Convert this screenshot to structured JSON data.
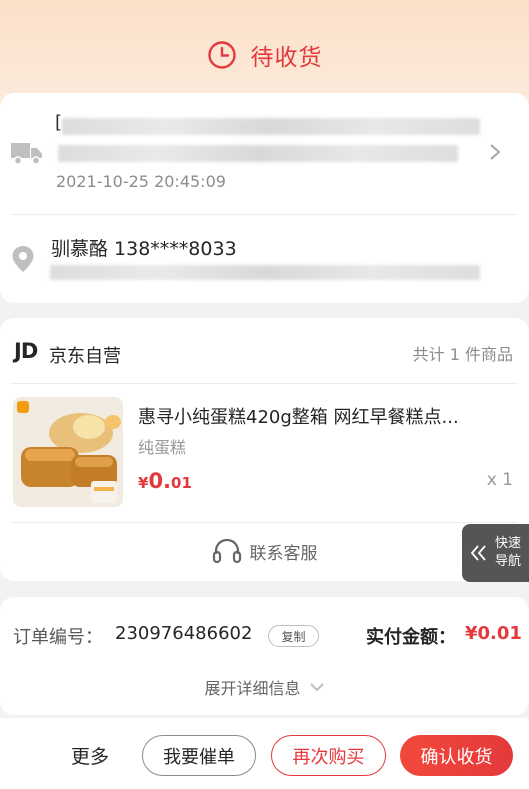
{
  "header": {
    "status": "待收货"
  },
  "logistics": {
    "time": "2021-10-25 20:45:09"
  },
  "receiver": {
    "name_phone": "驯慕酪 138****8033"
  },
  "shop": {
    "logo": "JD",
    "name": "京东自营",
    "count_text": "共计 1 件商品"
  },
  "product": {
    "title": "惠寻小纯蛋糕420g整箱 网红早餐糕点...",
    "spec": "纯蛋糕",
    "price_currency": "¥",
    "price_int": "0.",
    "price_dec": "01",
    "quantity": "x 1"
  },
  "service": {
    "label": "联系客服"
  },
  "quick_nav": {
    "line1": "快速",
    "line2": "导航"
  },
  "order": {
    "number_label": "订单编号：",
    "number": "230976486602",
    "copy_label": "复制",
    "paid_label": "实付金额：",
    "paid_amount": "¥0.01",
    "expand_label": "展开详细信息"
  },
  "actions": {
    "more": "更多",
    "urge": "我要催单",
    "rebuy": "再次购买",
    "confirm": "确认收货"
  },
  "colors": {
    "accent": "#e4393c"
  }
}
